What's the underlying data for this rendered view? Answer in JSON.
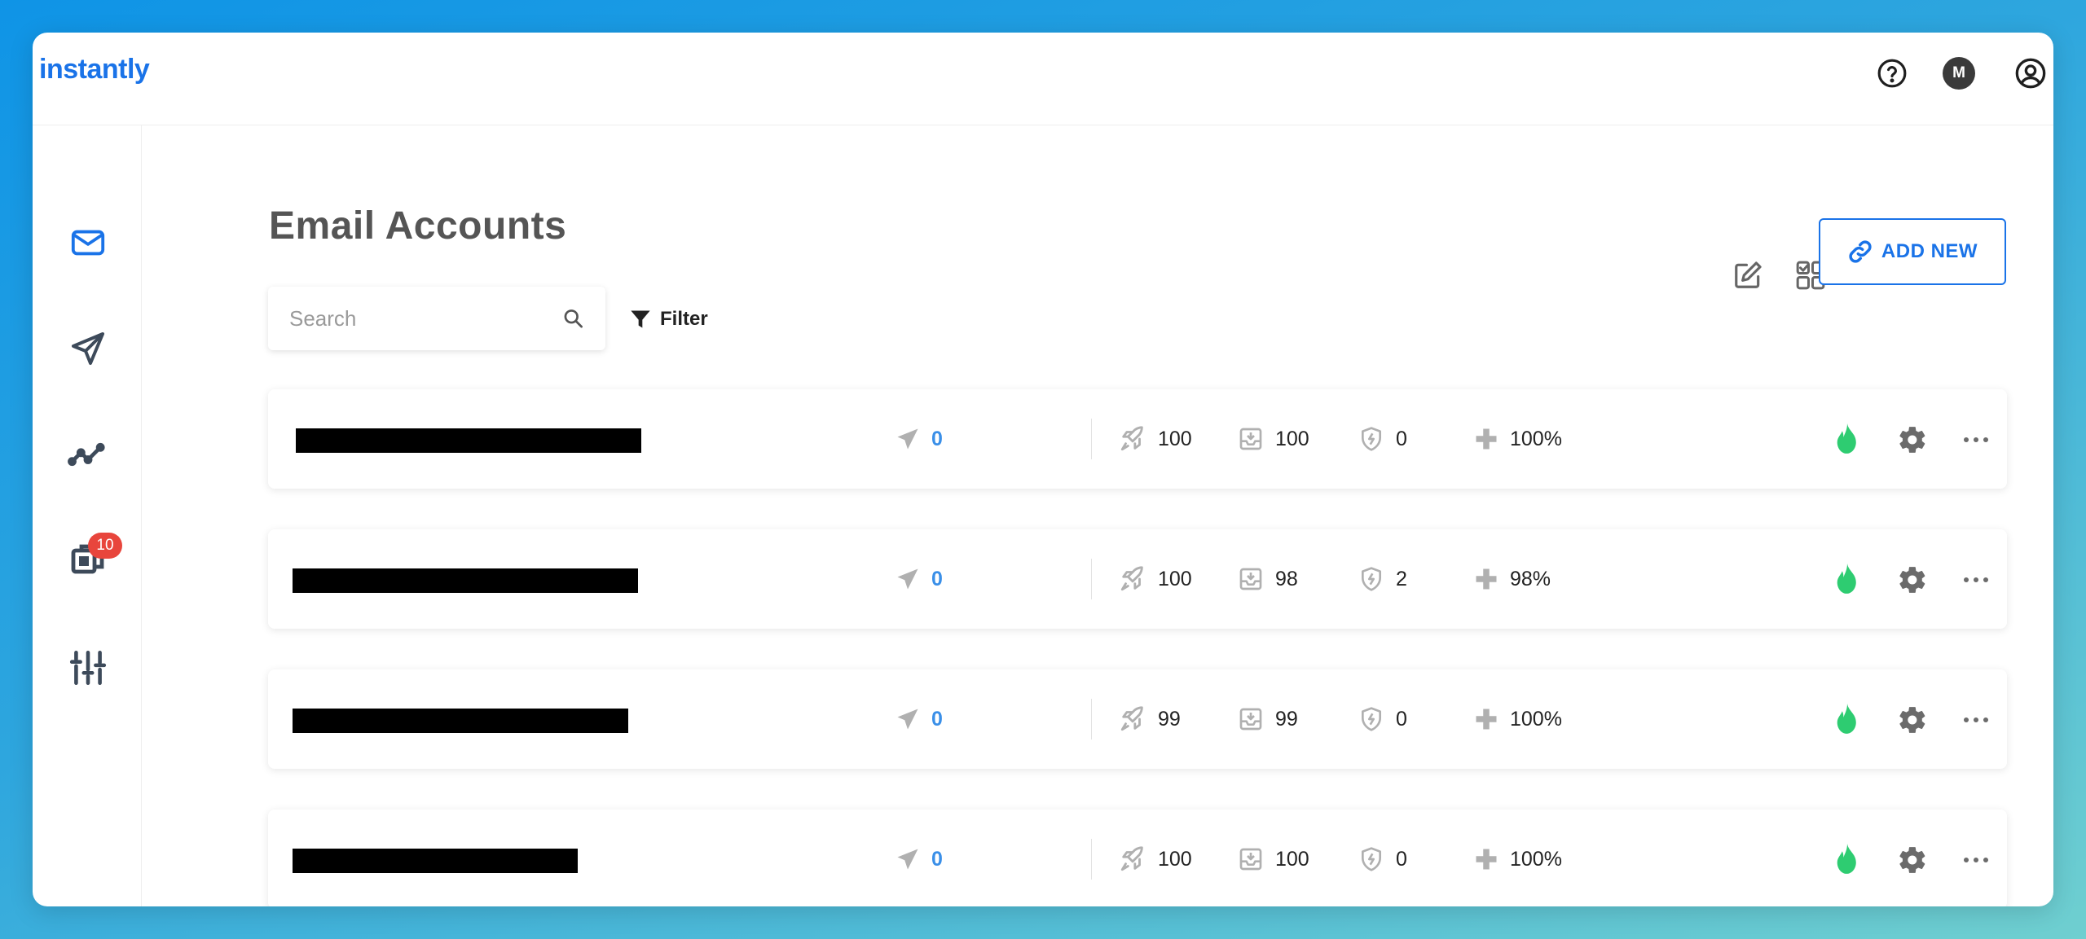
{
  "app": {
    "logo": "instantly"
  },
  "topbar": {
    "avatar_initial": "M"
  },
  "sidebar": {
    "items": [
      {
        "name": "email-accounts",
        "icon": "mail-icon",
        "active": true
      },
      {
        "name": "campaigns",
        "icon": "send-icon"
      },
      {
        "name": "analytics",
        "icon": "analytics-icon"
      },
      {
        "name": "unibox",
        "icon": "inbox-stack-icon",
        "badge": "10"
      },
      {
        "name": "settings",
        "icon": "sliders-icon"
      }
    ]
  },
  "page": {
    "title": "Email Accounts"
  },
  "search": {
    "placeholder": "Search"
  },
  "filter": {
    "label": "Filter"
  },
  "toolbar": {
    "add_new_label": "ADD NEW"
  },
  "colors": {
    "accent": "#1a73e8",
    "sent_value": "#3a8fe8",
    "warmup_flame": "#2ecc71",
    "badge": "#e8453c",
    "icon_gray": "#b0b0b0"
  },
  "accounts": [
    {
      "email_redacted": true,
      "sent": "0",
      "warmup": "100",
      "inbox": "100",
      "spam": "0",
      "health": "100%"
    },
    {
      "email_redacted": true,
      "sent": "0",
      "warmup": "100",
      "inbox": "98",
      "spam": "2",
      "health": "98%"
    },
    {
      "email_redacted": true,
      "sent": "0",
      "warmup": "99",
      "inbox": "99",
      "spam": "0",
      "health": "100%"
    },
    {
      "email_redacted": true,
      "sent": "0",
      "warmup": "100",
      "inbox": "100",
      "spam": "0",
      "health": "100%"
    }
  ]
}
